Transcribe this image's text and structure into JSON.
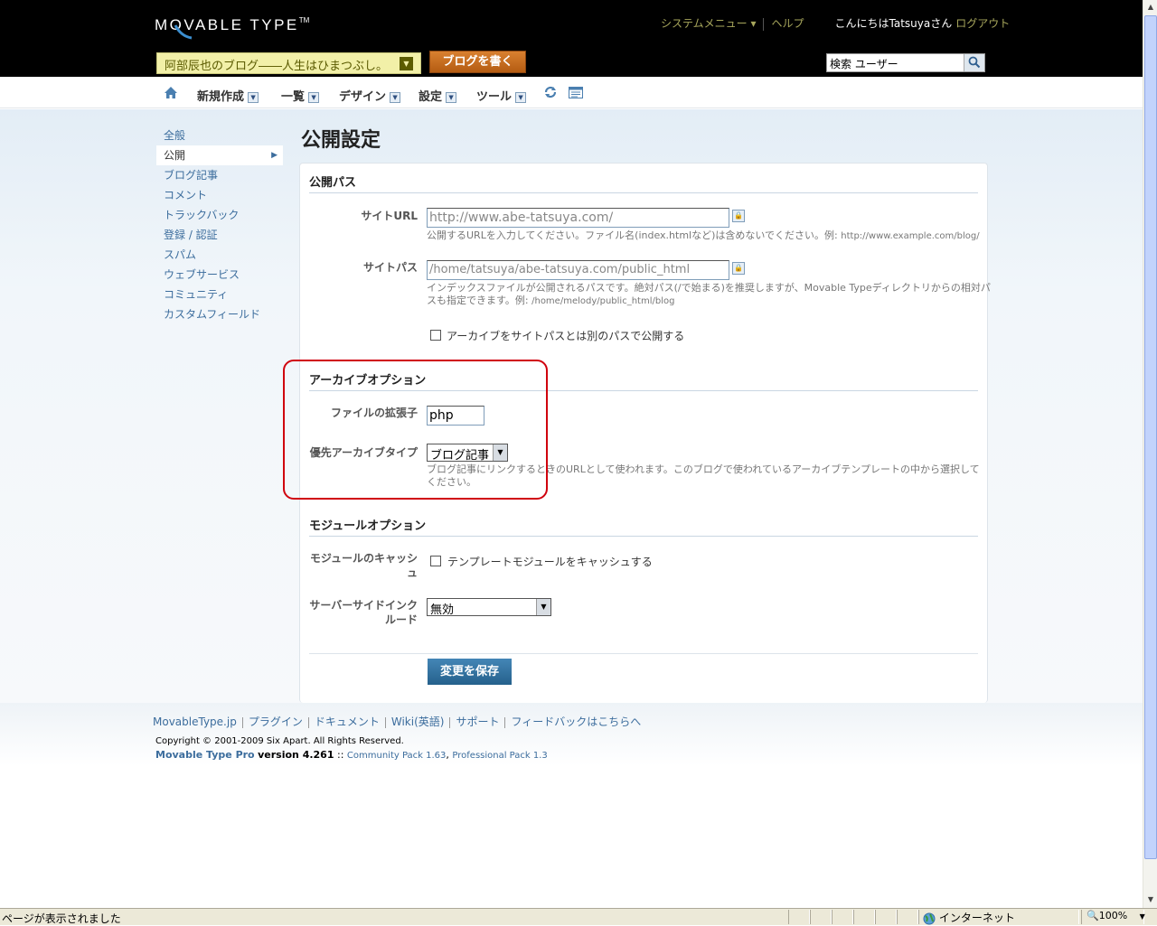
{
  "header": {
    "logo_text": "MOVABLE TYPE",
    "logo_tm": "TM",
    "system_menu": "システムメニュー ▾",
    "help": "ヘルプ",
    "greeting": "こんにちはTatsuyaさん",
    "logout": "ログアウト",
    "blog_name": "阿部辰也のブログ――人生はひまつぶし。",
    "write_button": "ブログを書く",
    "search_value": "検索 ユーザー"
  },
  "menubar": {
    "items": [
      {
        "label": "新規作成"
      },
      {
        "label": "一覧"
      },
      {
        "label": "デザイン"
      },
      {
        "label": "設定"
      },
      {
        "label": "ツール"
      }
    ]
  },
  "sidenav": {
    "items": [
      {
        "label": "全般"
      },
      {
        "label": "公開"
      },
      {
        "label": "ブログ記事"
      },
      {
        "label": "コメント"
      },
      {
        "label": "トラックバック"
      },
      {
        "label": "登録 / 認証"
      },
      {
        "label": "スパム"
      },
      {
        "label": "ウェブサービス"
      },
      {
        "label": "コミュニティ"
      },
      {
        "label": "カスタムフィールド"
      }
    ]
  },
  "main": {
    "title": "公開設定",
    "publish_path": {
      "section_title": "公開パス",
      "site_url_label": "サイトURL",
      "site_url_value": "http://www.abe-tatsuya.com/",
      "site_url_hint": "公開するURLを入力してください。ファイル名(index.htmlなど)は含めないでください。例: ",
      "site_url_example": "http://www.example.com/blog/",
      "site_path_label": "サイトパス",
      "site_path_value": "/home/tatsuya/abe-tatsuya.com/public_html",
      "site_path_hint_1": "インデックスファイルが公開されるパスです。絶対パス(/で始まる)を推奨しますが、Movable Typeディレクトリからの相対パ",
      "site_path_hint_2": "スも指定できます。例: ",
      "site_path_example": "/home/melody/public_html/blog",
      "archive_path_checkbox": "アーカイブをサイトパスとは別のパスで公開する"
    },
    "archive_options": {
      "section_title": "アーカイブオプション",
      "file_ext_label": "ファイルの拡張子",
      "file_ext_value": "php",
      "preferred_archive_label": "優先アーカイブタイプ",
      "preferred_archive_value": "ブログ記事",
      "preferred_archive_hint_1": "ブログ記事にリンクするときのURLとして使われます。このブログで使われているアーカイブテンプレートの中から選択して",
      "preferred_archive_hint_2": "ください。"
    },
    "module_options": {
      "section_title": "モジュールオプション",
      "cache_label_1": "モジュールのキャッシ",
      "cache_label_2": "ュ",
      "cache_checkbox": "テンプレートモジュールをキャッシュする",
      "ssi_label_1": "サーバーサイドインク",
      "ssi_label_2": "ルード",
      "ssi_value": "無効"
    },
    "save_button": "変更を保存"
  },
  "footer": {
    "links": [
      {
        "label": "MovableType.jp"
      },
      {
        "label": "プラグイン"
      },
      {
        "label": "ドキュメント"
      },
      {
        "label": "Wiki(英語)"
      },
      {
        "label": "サポート"
      },
      {
        "label": "フィードバックはこちらへ"
      }
    ],
    "copyright": "Copyright © 2001-2009 Six Apart. All Rights Reserved.",
    "product": "Movable Type Pro",
    "version": "version 4.261",
    "sep": " :: ",
    "community_pack": "Community Pack 1.63",
    "comma": ", ",
    "professional_pack": "Professional Pack 1.3"
  },
  "statusbar": {
    "status": "ページが表示されました",
    "zone": "インターネット",
    "zoom": "100%"
  },
  "colors": {
    "header_bg": "#000000",
    "accent_link": "#3c6d9d",
    "highlight_box": "#d0000d",
    "save_button": "#2d6b97",
    "write_button": "#c46a1f"
  }
}
